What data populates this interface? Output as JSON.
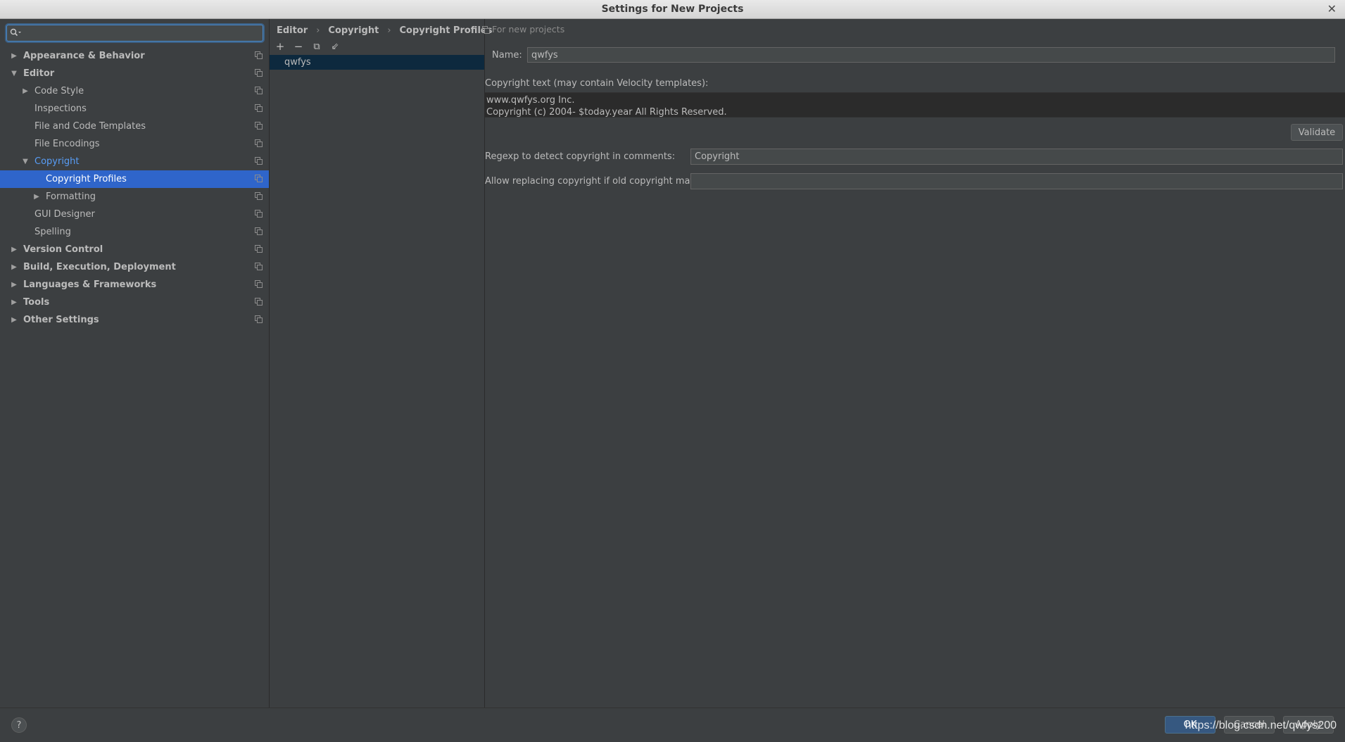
{
  "window": {
    "title": "Settings for New Projects",
    "close_glyph": "✕"
  },
  "search": {
    "value": "",
    "icon": "search-icon"
  },
  "tree": [
    {
      "label": "Appearance & Behavior",
      "level": 0,
      "arrow": "collapsed",
      "bold": true
    },
    {
      "label": "Editor",
      "level": 0,
      "arrow": "expanded",
      "bold": true
    },
    {
      "label": "Code Style",
      "level": 1,
      "arrow": "collapsed"
    },
    {
      "label": "Inspections",
      "level": 1,
      "arrow": "none"
    },
    {
      "label": "File and Code Templates",
      "level": 1,
      "arrow": "none"
    },
    {
      "label": "File Encodings",
      "level": 1,
      "arrow": "none"
    },
    {
      "label": "Copyright",
      "level": 1,
      "arrow": "expanded",
      "active": true
    },
    {
      "label": "Copyright Profiles",
      "level": 2,
      "arrow": "none",
      "selected": true
    },
    {
      "label": "Formatting",
      "level": 2,
      "arrow": "collapsed"
    },
    {
      "label": "GUI Designer",
      "level": 1,
      "arrow": "none"
    },
    {
      "label": "Spelling",
      "level": 1,
      "arrow": "none"
    },
    {
      "label": "Version Control",
      "level": 0,
      "arrow": "collapsed",
      "bold": true
    },
    {
      "label": "Build, Execution, Deployment",
      "level": 0,
      "arrow": "collapsed",
      "bold": true
    },
    {
      "label": "Languages & Frameworks",
      "level": 0,
      "arrow": "collapsed",
      "bold": true
    },
    {
      "label": "Tools",
      "level": 0,
      "arrow": "collapsed",
      "bold": true
    },
    {
      "label": "Other Settings",
      "level": 0,
      "arrow": "collapsed",
      "bold": true
    }
  ],
  "breadcrumb": [
    "Editor",
    "Copyright",
    "Copyright Profiles"
  ],
  "breadcrumb_sep": "›",
  "for_new_projects": "For new projects",
  "toolbar": {
    "add": "+",
    "remove": "−",
    "copy": "⧉",
    "import": "⇙"
  },
  "profiles": [
    "qwfys"
  ],
  "form": {
    "name_label": "Name:",
    "name_value": "qwfys",
    "copyright_text_label": "Copyright text (may contain Velocity templates):",
    "copyright_text_line1": "www.qwfys.org Inc.",
    "copyright_text_line2": "Copyright (c) 2004- $today.year All Rights Reserved.",
    "validate_label": "Validate",
    "regexp_label": "Regexp to detect copyright in comments:",
    "regexp_value": "Copyright",
    "allow_label": "Allow replacing copyright if old copyright matches:",
    "allow_value": ""
  },
  "footer": {
    "help": "?",
    "ok": "OK",
    "cancel": "Cancel",
    "apply": "Apply",
    "watermark": "https://blog.csdn.net/qwfys200"
  },
  "colors": {
    "background": "#3c3f41",
    "selection": "#2f65ca",
    "active_link": "#589df6",
    "primary_button": "#365880"
  }
}
